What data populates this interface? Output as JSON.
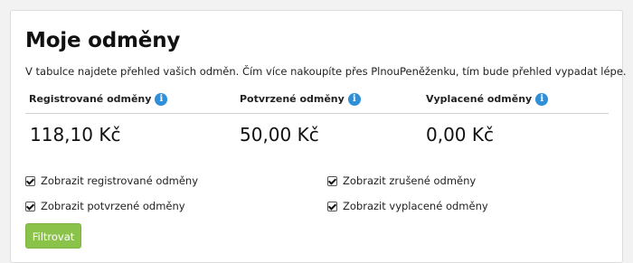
{
  "page": {
    "title": "Moje odměny",
    "intro": "V tabulce najdete přehled vašich odměn. Čím více nakoupíte přes PlnouPeněženku, tím bude přehled vypadat lépe."
  },
  "stats": [
    {
      "label": "Registrované odměny",
      "value": "118,10 Kč"
    },
    {
      "label": "Potvrzené odměny",
      "value": "50,00 Kč"
    },
    {
      "label": "Vyplacené odměny",
      "value": "0,00 Kč"
    }
  ],
  "info_icon_glyph": "i",
  "filters": [
    {
      "label": "Zobrazit registrované odměny",
      "checked": true
    },
    {
      "label": "Zobrazit zrušené odměny",
      "checked": true
    },
    {
      "label": "Zobrazit potvrzené odměny",
      "checked": true
    },
    {
      "label": "Zobrazit vyplacené odměny",
      "checked": true
    }
  ],
  "filter_button_label": "Filtrovat",
  "colors": {
    "accent_button": "#8bc34a",
    "info_icon": "#2f8fd8"
  }
}
